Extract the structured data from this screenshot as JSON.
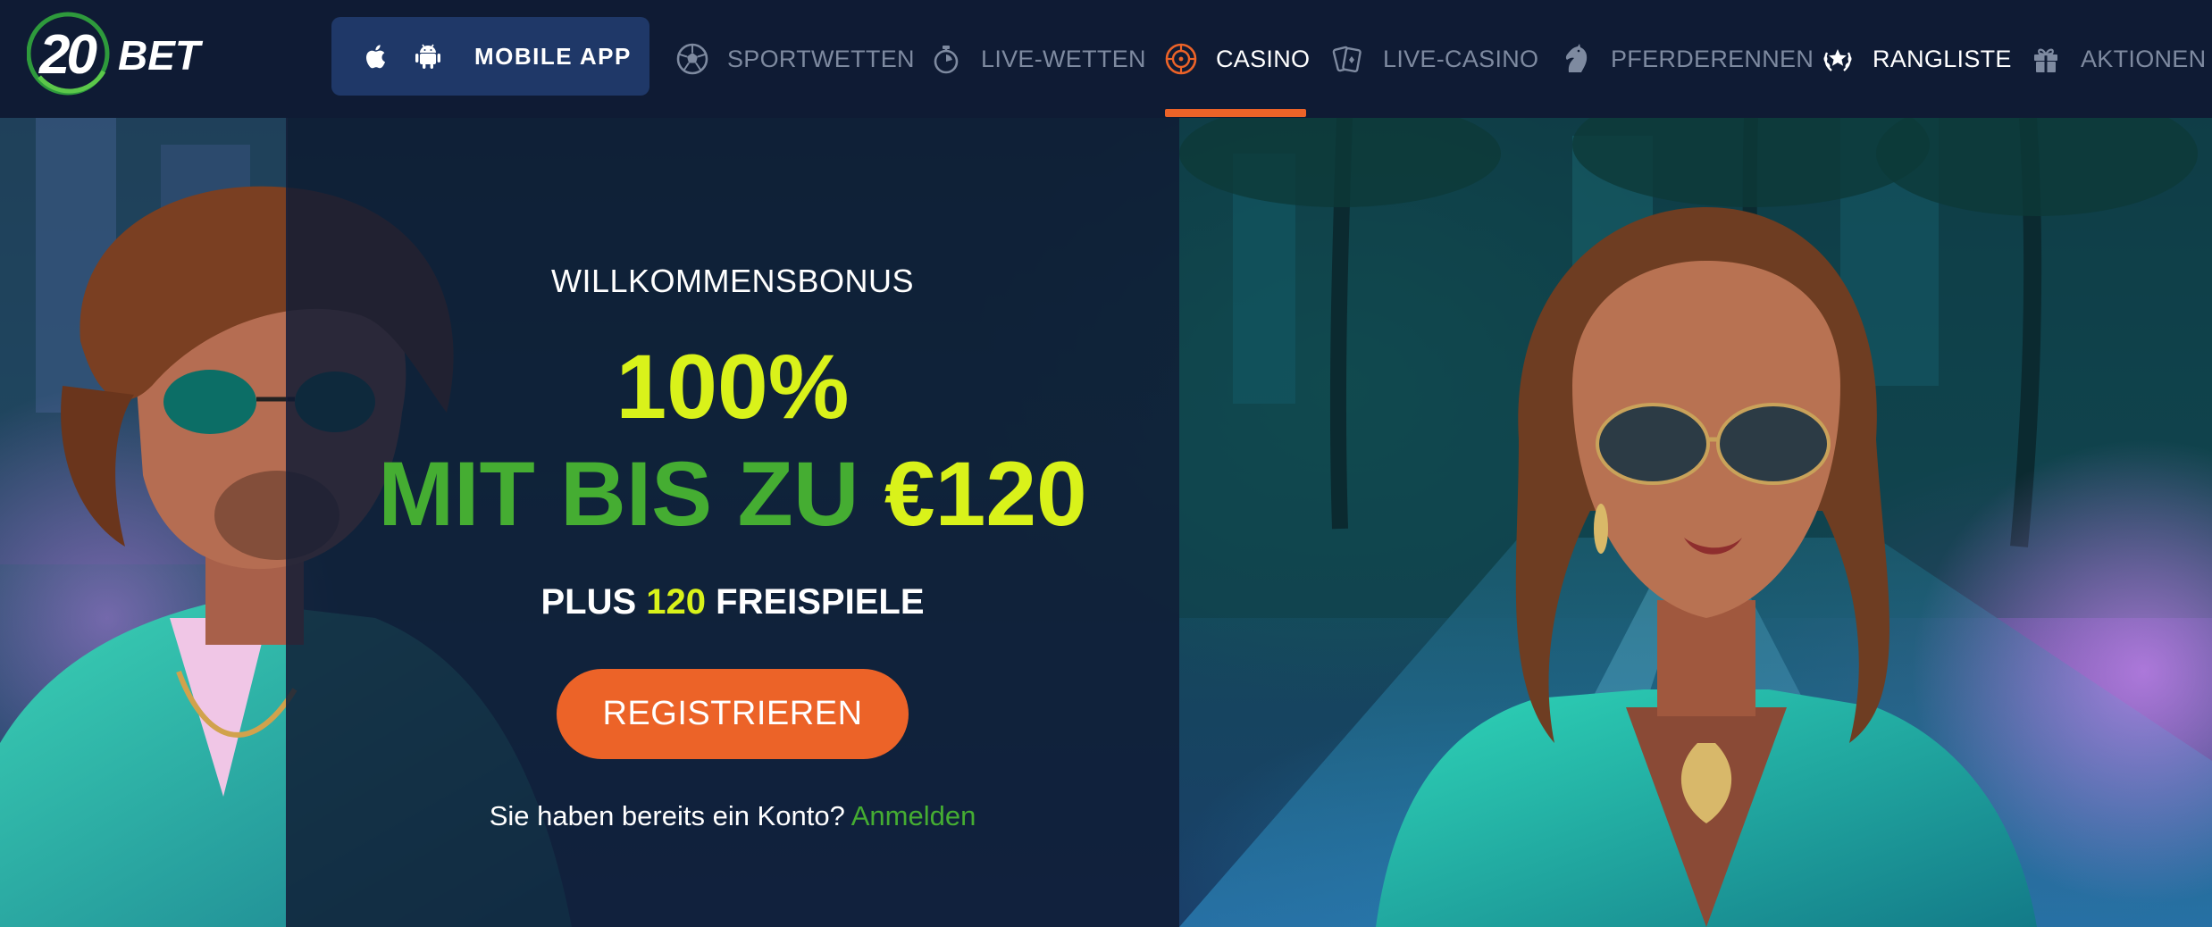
{
  "header": {
    "brand": "20 BET",
    "mobile_app_label": "MOBILE APP",
    "nav": [
      {
        "label": "SPORTWETTEN",
        "icon": "soccer-ball-icon",
        "state": "inactive"
      },
      {
        "label": "LIVE-WETTEN",
        "icon": "stopwatch-icon",
        "state": "inactive"
      },
      {
        "label": "CASINO",
        "icon": "roulette-icon",
        "state": "active"
      },
      {
        "label": "LIVE-CASINO",
        "icon": "cards-icon",
        "state": "inactive"
      },
      {
        "label": "PFERDERENNEN",
        "icon": "horse-icon",
        "state": "inactive"
      },
      {
        "label": "RANGLISTE",
        "icon": "laurel-star-icon",
        "state": "highlighted"
      },
      {
        "label": "AKTIONEN",
        "icon": "gift-icon",
        "state": "inactive"
      }
    ]
  },
  "promo": {
    "welcome": "WILLKOMMENSBONUS",
    "percent": "100%",
    "line2_green": "MIT BIS ZU ",
    "line2_yellow": "€120",
    "plus_prefix": "PLUS ",
    "plus_number": "120",
    "plus_suffix": " FREISPIELE",
    "register_label": "REGISTRIEREN",
    "login_prompt": "Sie haben bereits ein Konto? ",
    "login_link": "Anmelden"
  },
  "colors": {
    "header_bg": "#0f1b34",
    "mobile_app_bg": "#1f3868",
    "nav_text_inactive": "#7e8aa0",
    "accent_orange": "#ec6328",
    "highlight_yellow": "#d9f21a",
    "brand_green": "#45ad32"
  }
}
